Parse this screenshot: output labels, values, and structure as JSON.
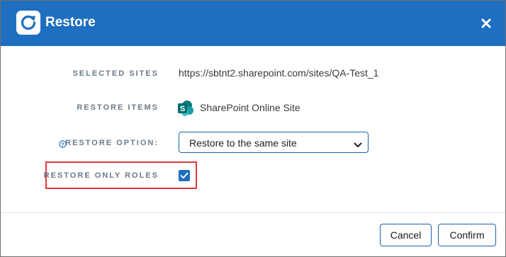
{
  "dialog": {
    "title": "Restore",
    "icon": "refresh-icon",
    "close_icon": "close-icon"
  },
  "fields": {
    "selected_sites": {
      "label": "SELECTED SITES",
      "value": "https://sbtnt2.sharepoint.com/sites/QA-Test_1"
    },
    "restore_items": {
      "label": "RESTORE ITEMS",
      "value": "SharePoint Online Site",
      "icon": "sharepoint-icon"
    },
    "restore_option": {
      "label": "RESTORE OPTION:",
      "info_icon": "help-icon",
      "selected": "Restore to the same site"
    },
    "restore_only_roles": {
      "label": "RESTORE ONLY ROLES",
      "checked": true
    }
  },
  "buttons": {
    "cancel": "Cancel",
    "confirm": "Confirm"
  },
  "colors": {
    "header": "#1f6fc0",
    "accent": "#1f5fa8",
    "highlight": "#e0393b",
    "label": "#6a7a88"
  }
}
